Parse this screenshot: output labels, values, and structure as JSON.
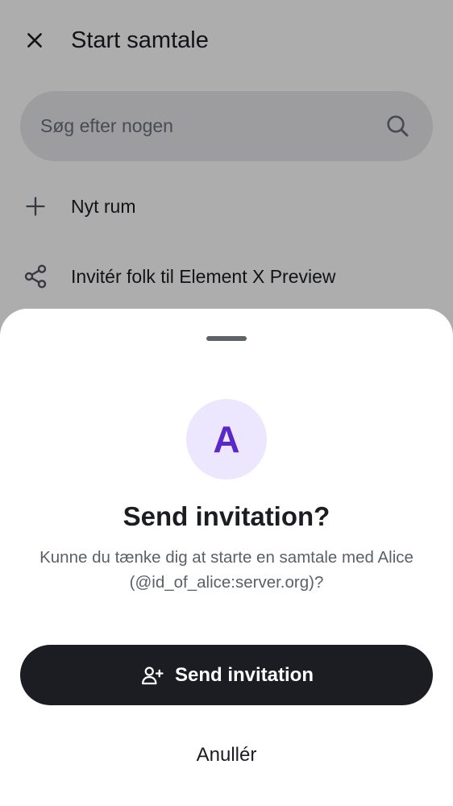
{
  "header": {
    "title": "Start samtale",
    "close_icon": "close-icon"
  },
  "search": {
    "placeholder": "Søg efter nogen",
    "value": "",
    "icon": "search-icon"
  },
  "menu": [
    {
      "label": "Nyt rum",
      "icon": "plus-icon"
    },
    {
      "label": "Invitér folk til Element X Preview",
      "icon": "share-icon"
    }
  ],
  "sheet": {
    "avatar_letter": "A",
    "title": "Send invitation?",
    "message": "Kunne du tænke dig at starte en samtale med Alice (@id_of_alice:server.org)?",
    "primary_label": "Send invitation",
    "primary_icon": "user-add-icon",
    "cancel_label": "Anullér"
  },
  "colors": {
    "primary_button": "#1b1d22",
    "avatar_background": "#ece6ff",
    "avatar_text": "#5a28c8",
    "scrim": "rgba(0,0,0,0.32)"
  }
}
